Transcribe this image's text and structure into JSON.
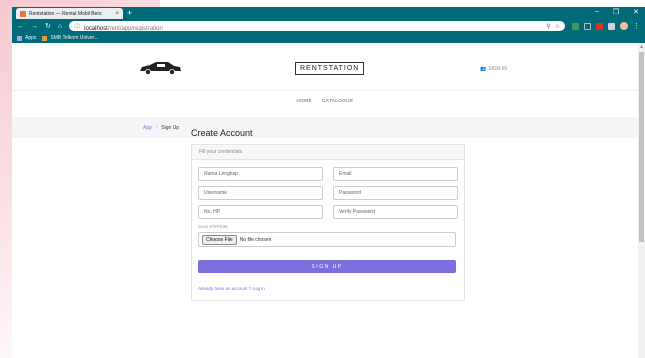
{
  "browser": {
    "tab_title": "Rentstation — Rental Mobil Bers",
    "tab_close": "×",
    "new_tab": "+",
    "window_controls": [
      "−",
      "❐",
      "✕"
    ],
    "address_host": "localhost",
    "address_path": "/rent/app/registration",
    "bookmarks": [
      "Apps",
      "SMB Telkom Univer..."
    ]
  },
  "header": {
    "brand": "RENTSTATION",
    "sign_in": "SIGN IN"
  },
  "menu": [
    "HOME",
    "CATALOGUE"
  ],
  "breadcrumb": {
    "app": "App",
    "separator": "/",
    "current": "Sign Up"
  },
  "form": {
    "title": "Create Account",
    "subtitle": "Fill your credentials",
    "fields": {
      "name": "Nama Lengkap",
      "email": "Email",
      "username": "Username",
      "password": "Password",
      "phone": "No. HP",
      "verify_password": "Verify Password"
    },
    "scan_label": "Scan KTP/SIM",
    "file_button": "Choose File",
    "file_status": "No file chosen",
    "submit": "SIGN UP",
    "login_link": "Already have an account ? Log in"
  },
  "colors": {
    "chrome": "#006a79",
    "accent": "#7b6fe0"
  }
}
